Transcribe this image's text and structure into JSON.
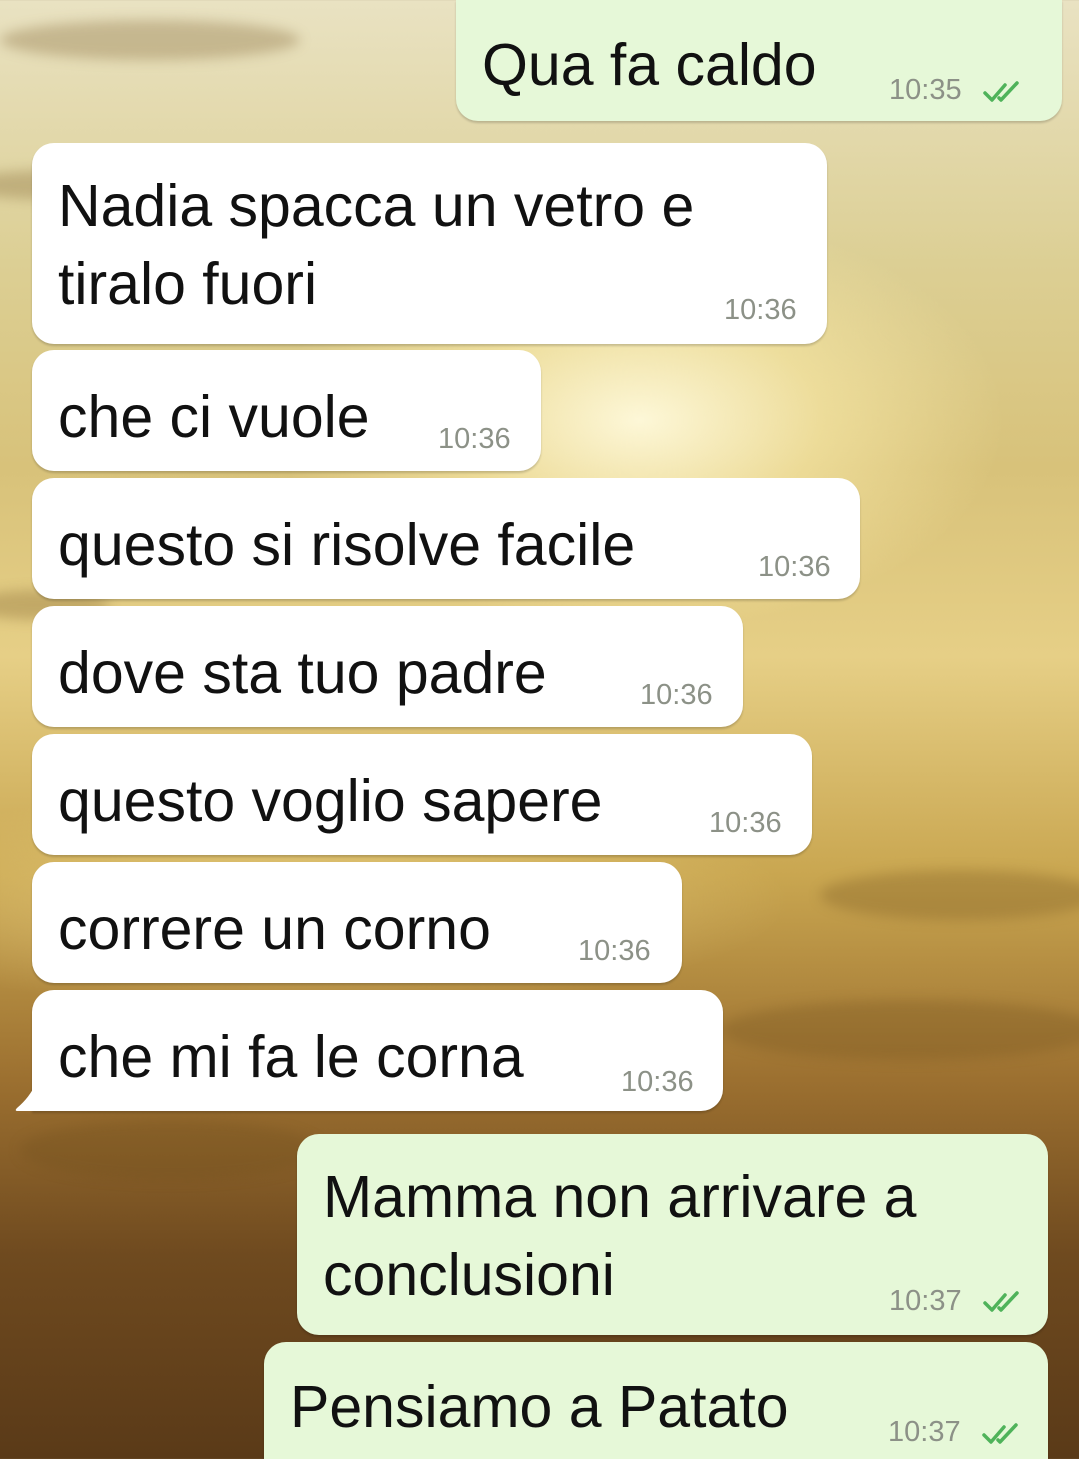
{
  "colors": {
    "incoming_bubble": "#ffffff",
    "outgoing_bubble": "#e6f8d8",
    "read_ticks": "#4fb35a",
    "timestamp": "#8c9187"
  },
  "messages": [
    {
      "direction": "outgoing",
      "text": "Qua fa caldo",
      "time": "10:35",
      "status": "read",
      "status_icon": "double-check-icon"
    },
    {
      "direction": "incoming",
      "text": "Nadia spacca un vetro e\ntiralo fuori",
      "time": "10:36"
    },
    {
      "direction": "incoming",
      "text": "che ci vuole",
      "time": "10:36"
    },
    {
      "direction": "incoming",
      "text": "questo si risolve facile",
      "time": "10:36"
    },
    {
      "direction": "incoming",
      "text": "dove sta tuo padre",
      "time": "10:36"
    },
    {
      "direction": "incoming",
      "text": "questo voglio sapere",
      "time": "10:36"
    },
    {
      "direction": "incoming",
      "text": "correre un corno",
      "time": "10:36"
    },
    {
      "direction": "incoming",
      "text": "che mi fa le corna",
      "time": "10:36"
    },
    {
      "direction": "outgoing",
      "text": "Mamma non arrivare a\nconclusioni",
      "time": "10:37",
      "status": "read",
      "status_icon": "double-check-icon"
    },
    {
      "direction": "outgoing",
      "text": "Pensiamo a Patato",
      "time": "10:37",
      "status": "read",
      "status_icon": "double-check-icon"
    }
  ]
}
